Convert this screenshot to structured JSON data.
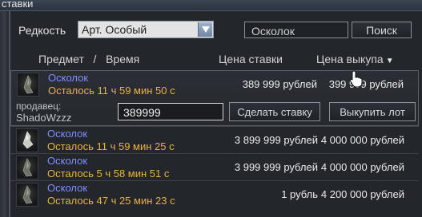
{
  "window": {
    "title": "ставки"
  },
  "filter": {
    "rarity_label": "Редкость",
    "rarity_value": "Арт. Особый",
    "search_value": "Осколок",
    "search_button": "Поиск"
  },
  "columns": {
    "item_time": "Предмет   /   Время",
    "bid_price": "Цена ставки",
    "buyout_price": "Цена выкупа"
  },
  "rows": [
    {
      "name": "Осколок",
      "time_left": "Осталось 11 ч 59 мин 50 с",
      "bid": "389 999 рублей",
      "buyout": "399 999 рублей"
    },
    {
      "name": "Осколок",
      "time_left": "Осталось 11 ч 59 мин 25 с",
      "bid": "3 899 999 рублей",
      "buyout": "4 000 000 рублей"
    },
    {
      "name": "Осколок",
      "time_left": "Осталось 5 ч 58 мин 51 с",
      "bid": "3 999 999 рублей",
      "buyout": "4 000 000 рублей"
    },
    {
      "name": "Осколок",
      "time_left": "Осталось 47 ч 25 мин 23 с",
      "bid": "1 рубль",
      "buyout": "4 200 000 рублей"
    }
  ],
  "selected": {
    "seller_label": "продавец:",
    "seller_name": "ShadoWzzz",
    "bid_input_value": "389999",
    "bid_button": "Сделать ставку",
    "buyout_button": "Выкупить лот"
  },
  "icons": {
    "dropdown": "chevron-down-icon",
    "sort": "sort-desc-icon",
    "item": "shard-artifact-icon",
    "cursor": "hand-pointer-icon"
  }
}
